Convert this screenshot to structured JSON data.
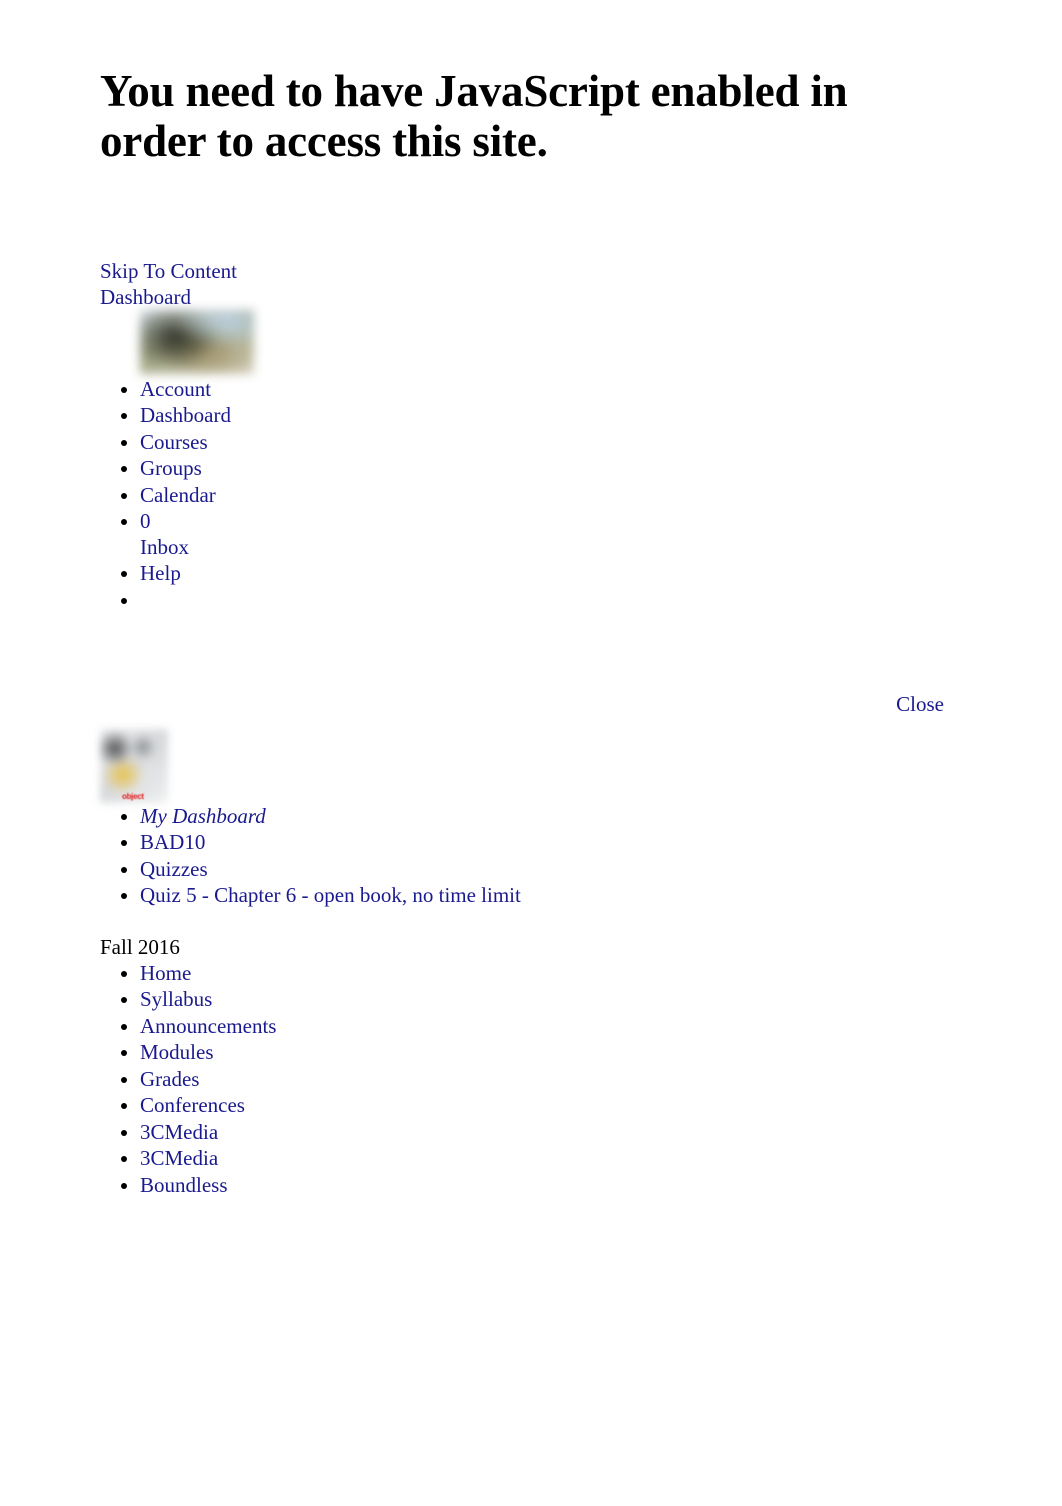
{
  "heading": "You need to have JavaScript enabled in order to access this site.",
  "skip_links": [
    {
      "label": "Skip To Content",
      "name": "skip-to-content-link"
    },
    {
      "label": "Dashboard",
      "name": "dashboard-link"
    }
  ],
  "account_nav": {
    "avatar": {
      "alt": "Account profile picture",
      "label": "Account"
    },
    "items": [
      {
        "label": "Dashboard"
      },
      {
        "label": "Courses"
      },
      {
        "label": "Groups"
      },
      {
        "label": "Calendar"
      }
    ],
    "inbox": {
      "count": "0",
      "label": "Inbox"
    },
    "help": {
      "label": "Help"
    }
  },
  "close": {
    "label": "Close"
  },
  "object_placeholder": {
    "text": "object"
  },
  "breadcrumb": [
    {
      "label": "My Dashboard",
      "italic": true
    },
    {
      "label": "BAD10",
      "italic": false
    },
    {
      "label": "Quizzes",
      "italic": false
    },
    {
      "label": "Quiz 5 - Chapter 6 - open book, no time limit",
      "italic": false
    }
  ],
  "term": "Fall 2016",
  "course_nav": [
    {
      "label": "Home"
    },
    {
      "label": "Syllabus"
    },
    {
      "label": "Announcements"
    },
    {
      "label": "Modules"
    },
    {
      "label": "Grades"
    },
    {
      "label": "Conferences"
    },
    {
      "label": "3CMedia"
    },
    {
      "label": "3CMedia"
    },
    {
      "label": "Boundless"
    }
  ],
  "colors": {
    "link": "#1a1a8e",
    "text": "#000000",
    "background": "#ffffff",
    "object_text": "#e01b1b"
  }
}
